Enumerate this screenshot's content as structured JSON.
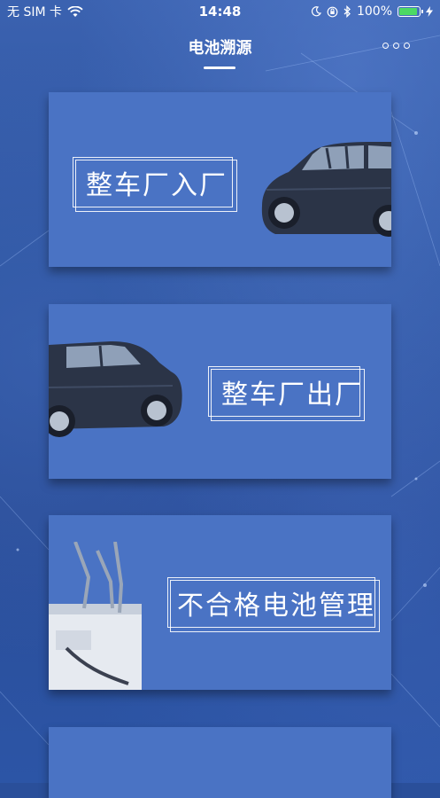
{
  "status_bar": {
    "carrier": "无 SIM 卡",
    "time": "14:48",
    "battery_percent": "100%",
    "battery_level": 1.0
  },
  "nav": {
    "title": "电池溯源"
  },
  "cards": [
    {
      "label": "整车厂入厂"
    },
    {
      "label": "整车厂出厂"
    },
    {
      "label": "不合格电池管理"
    }
  ],
  "colors": {
    "card_bg": "#4a73c4",
    "page_bg": "#2c539f",
    "battery_fill": "#4cd964"
  }
}
